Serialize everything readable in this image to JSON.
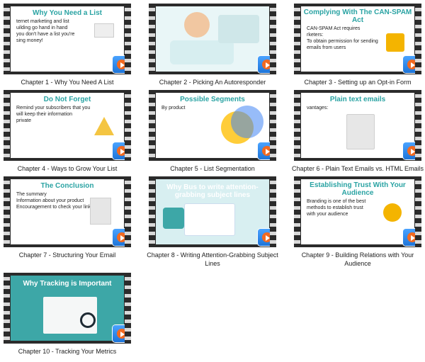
{
  "tiles": [
    {
      "title": "Why You Need a List",
      "body": [
        "ternet marketing and list",
        "uilding go hand in hand",
        "you don't have a list you're",
        "sing money!"
      ],
      "caption": "Chapter 1 - Why You Need A List"
    },
    {
      "title": "",
      "body": [],
      "caption": "Chapter 2 - Picking An Autoresponder"
    },
    {
      "title": "Complying With The CAN-SPAM Act",
      "body": [
        "CAN-SPAM Act requires",
        "rketers:",
        "To obtain permission for sending",
        "emails from users"
      ],
      "caption": "Chapter 3 - Setting up an Opt-in Form"
    },
    {
      "title": "Do Not Forget",
      "body": [
        "Remind your subscribers that you",
        "will keep their information",
        "private"
      ],
      "caption": "Chapter 4 - Ways to Grow Your List"
    },
    {
      "title": "Possible Segments",
      "body": [
        "By product"
      ],
      "caption": "Chapter 5 - List Segmentation"
    },
    {
      "title": "Plain text emails",
      "body": [
        "vantages:"
      ],
      "caption": "Chapter 6 - Plain Text Emails vs. HTML Emails"
    },
    {
      "title": "The Conclusion",
      "body": [
        "The summary",
        "Information about your product",
        "Encouragement to check your link"
      ],
      "caption": "Chapter 7 - Structuring Your Email"
    },
    {
      "title": "Why Bus to write attention-grabbing subject lines",
      "body": [],
      "caption": "Chapter 8 - Writing Attention-Grabbing Subject Lines"
    },
    {
      "title": "Establishing Trust With Your Audience",
      "body": [
        "Branding is one of the best",
        "methods to establish trust",
        "with your audience"
      ],
      "caption": "Chapter 9 - Building Relations with Your Audience"
    },
    {
      "title": "Why Tracking is Important",
      "body": [],
      "caption": "Chapter 10 - Tracking Your Metrics"
    }
  ]
}
